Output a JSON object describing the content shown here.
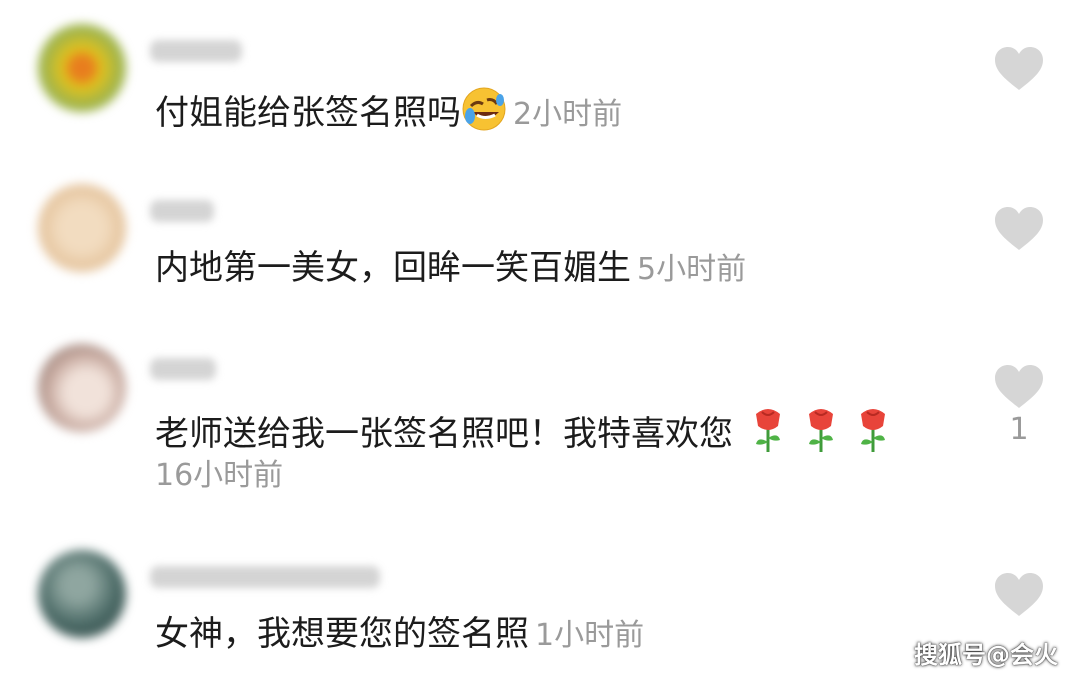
{
  "comments": [
    {
      "text": "付姐能给张签名照吗",
      "time": "2小时前",
      "likes": "",
      "emoji": "rofl-emoji",
      "avatar_color": "#d6b825"
    },
    {
      "text": "内地第一美女，回眸一笑百媚生",
      "time": "5小时前",
      "likes": "",
      "avatar_color": "#e8c9a2"
    },
    {
      "text": "老师送给我一张签名照吧！我特喜欢您",
      "time": "16小时前",
      "likes": "1",
      "emoji": "rose-emoji",
      "avatar_color": "#cbb5ac"
    },
    {
      "text": "女神，我想要您的签名照",
      "time": "1小时前",
      "likes": "",
      "avatar_color": "#4b6a66"
    }
  ],
  "watermark": "搜狐号@会火",
  "colors": {
    "heart": "#d6d6d6",
    "text": "#1c1c1c",
    "meta": "#9a9a9a"
  }
}
